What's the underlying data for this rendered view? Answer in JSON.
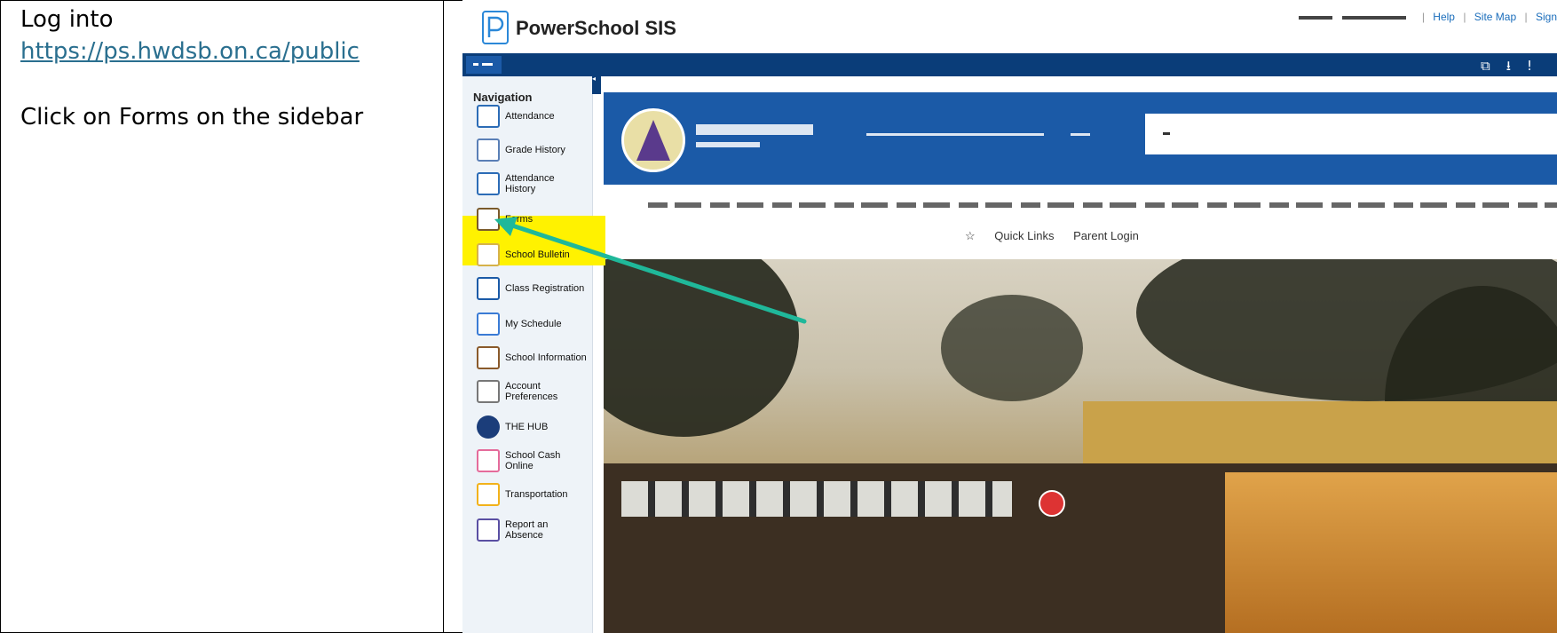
{
  "instructions": {
    "step1_text": "Log into",
    "step1_link": "https://ps.hwdsb.on.ca/public",
    "step2_text": "Click on Forms on the sidebar"
  },
  "app": {
    "brand": "PowerSchool SIS",
    "top_links": [
      "Help",
      "Site Map",
      "Sign"
    ]
  },
  "sidebar": {
    "title": "Navigation",
    "items": [
      {
        "label": "Attendance",
        "icon": "attendance-icon"
      },
      {
        "label": "Grade History",
        "icon": "grade-history-icon"
      },
      {
        "label": "Attendance History",
        "icon": "attendance-history-icon"
      },
      {
        "label": "Forms",
        "icon": "forms-icon"
      },
      {
        "label": "School Bulletin",
        "icon": "school-bulletin-icon"
      },
      {
        "label": "Class Registration",
        "icon": "class-registration-icon"
      },
      {
        "label": "My Schedule",
        "icon": "my-schedule-icon"
      },
      {
        "label": "School Information",
        "icon": "school-information-icon"
      },
      {
        "label": "Account Preferences",
        "icon": "account-preferences-icon"
      },
      {
        "label": "THE HUB",
        "icon": "hub-icon"
      },
      {
        "label": "School Cash Online",
        "icon": "school-cash-icon"
      },
      {
        "label": "Transportation",
        "icon": "bus-icon"
      },
      {
        "label": "Report an Absence",
        "icon": "report-absence-icon"
      }
    ]
  },
  "main": {
    "quick_links": "Quick Links",
    "parent_login": "Parent Login"
  },
  "colors": {
    "nav_blue": "#0a3d79",
    "header_blue": "#1b5aa7",
    "highlight": "#fff200",
    "arrow": "#1fb89a",
    "link": "#2a6f8f"
  }
}
